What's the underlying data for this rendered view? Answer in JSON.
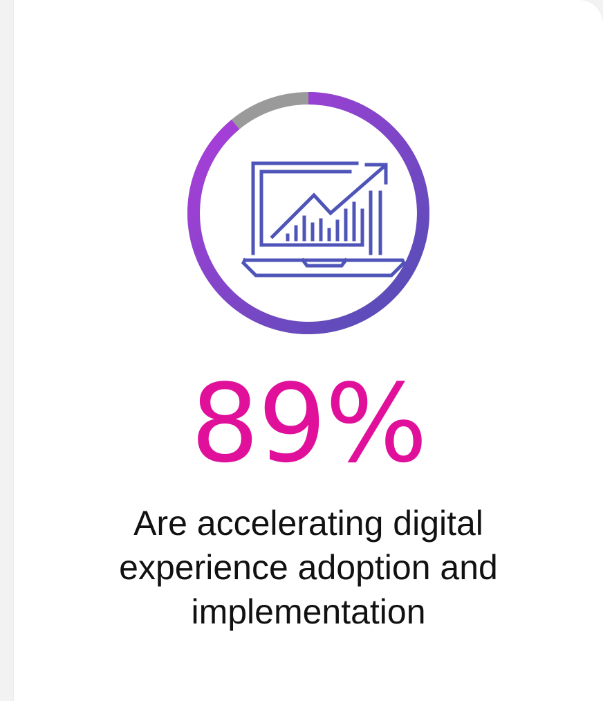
{
  "stat": {
    "value": "89%",
    "progress": 0.89,
    "caption": "Are accelerating digital experience adoption and implementation"
  },
  "colors": {
    "stat_text": "#e0109a",
    "ring_start": "#4f4fb4",
    "ring_end": "#a93ad8",
    "ring_remainder": "#9a9a9a",
    "icon_stroke": "#4f55b8",
    "caption_text": "#111111"
  },
  "icon": {
    "name": "laptop-growth-chart-icon"
  }
}
